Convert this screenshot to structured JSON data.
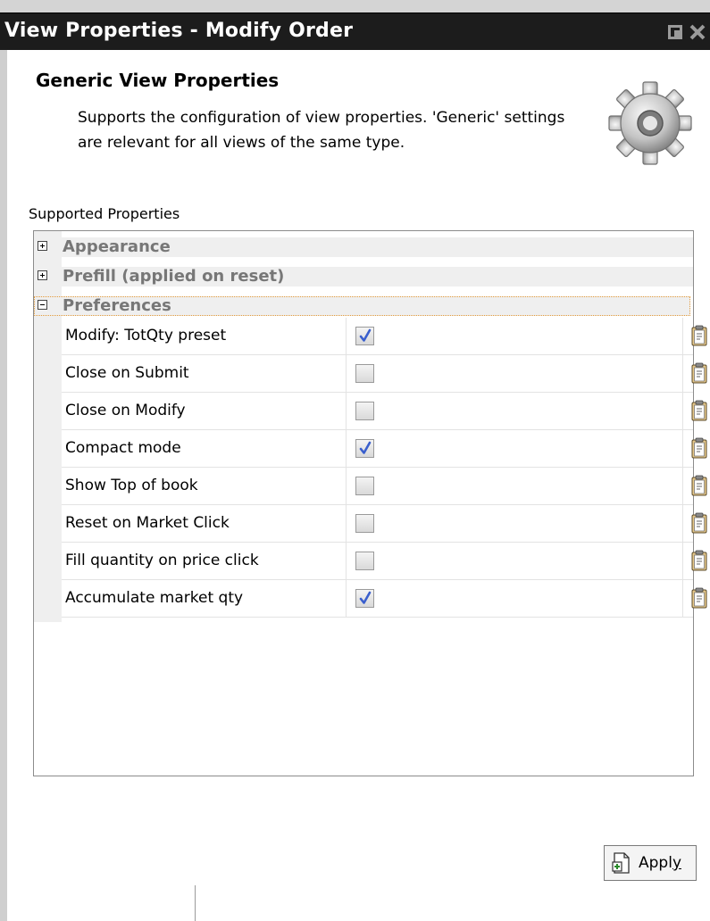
{
  "window": {
    "title": "View Properties - Modify Order"
  },
  "header": {
    "title": "Generic View Properties",
    "description": "Supports the configuration of view properties. 'Generic' settings are relevant for all views of the same type."
  },
  "supported_label": "Supported Properties",
  "categories": [
    {
      "label": "Appearance",
      "expanded": false
    },
    {
      "label": "Prefill (applied on reset)",
      "expanded": false
    },
    {
      "label": "Preferences",
      "expanded": true
    }
  ],
  "preferences": [
    {
      "label": "Modify: TotQty preset",
      "checked": true
    },
    {
      "label": "Close on Submit",
      "checked": false
    },
    {
      "label": "Close on Modify",
      "checked": false
    },
    {
      "label": "Compact mode",
      "checked": true
    },
    {
      "label": "Show Top of book",
      "checked": false
    },
    {
      "label": "Reset on Market Click",
      "checked": false
    },
    {
      "label": "Fill quantity on price click",
      "checked": false
    },
    {
      "label": "Accumulate market qty",
      "checked": true
    }
  ],
  "apply_button": {
    "label_prefix": "Appl",
    "label_mnemonic": "y"
  },
  "colors": {
    "titlebar": "#1c1c1c",
    "category_text": "#777777",
    "check_mark": "#3a5fcd",
    "selection_outline": "#e39a3a"
  },
  "icons": {
    "header": "gear-icon",
    "row_action": "clipboard-icon",
    "apply": "apply-icon",
    "restore": "restore-icon",
    "close": "close-icon"
  }
}
